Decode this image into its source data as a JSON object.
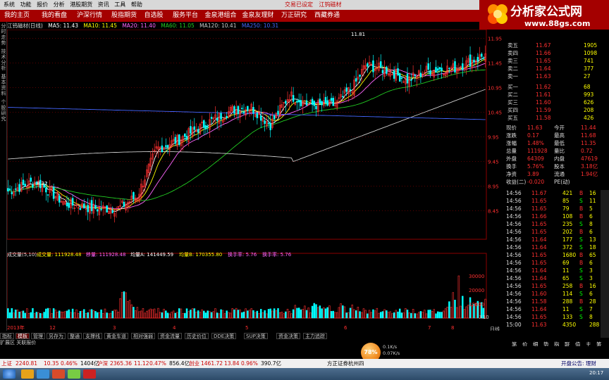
{
  "menu": [
    "系统",
    "功能",
    "报价",
    "分析",
    "港股期货",
    "资讯",
    "工具",
    "帮助"
  ],
  "window_title": "交易已设定",
  "window_stock": "江钨磁材",
  "nav": [
    {
      "label": "我的主页",
      "selected": false
    },
    {
      "label": "我的看盘",
      "selected": false
    },
    {
      "label": "沪深行情",
      "selected": false
    },
    {
      "label": "股指期货",
      "selected": false
    },
    {
      "label": "自选股",
      "selected": false
    },
    {
      "label": "服务平台",
      "selected": false
    },
    {
      "label": "金泉港组合",
      "selected": false
    },
    {
      "label": "金泉友理财",
      "selected": false
    },
    {
      "label": "万正研究",
      "selected": false
    },
    {
      "label": "西藏券通",
      "selected": false
    }
  ],
  "logo": {
    "title": "分析家公式网",
    "url": "www.88gs.com"
  },
  "left_tabs": [
    "分时走势",
    "技术分析",
    "基本资料",
    "个股研究"
  ],
  "info": {
    "stock": "江钨磁材(日线)",
    "ma5": "MA5: 11.43",
    "ma10": "MA10: 11.45",
    "ma20": "MA20: 11.40",
    "ma60": "MA60: 11.05",
    "ma120": "MA120: 10.41",
    "ma250": "MA250: 10.31"
  },
  "chart_data": [
    {
      "type": "candlestick",
      "title": "江钨磁材(日线)",
      "ylim": [
        7.9,
        12.1
      ],
      "yticks": [
        "11.95",
        "11.45",
        "10.95",
        "10.45",
        "9.95",
        "9.45",
        "8.95",
        "8.45"
      ],
      "ytick_values": [
        11.95,
        11.45,
        10.95,
        10.45,
        9.95,
        9.45,
        8.95,
        8.45
      ],
      "annotations": [
        "11.81",
        "8.32"
      ],
      "series": [
        {
          "name": "MA5",
          "color": "#ffffff"
        },
        {
          "name": "MA10",
          "color": "#ffff00"
        },
        {
          "name": "MA20",
          "color": "#ff66ff"
        },
        {
          "name": "MA60",
          "color": "#22cc22"
        },
        {
          "name": "MA120",
          "color": "#cccccc"
        },
        {
          "name": "MA250",
          "color": "#4466ff"
        }
      ]
    },
    {
      "type": "bar",
      "title": "成交量",
      "ylim": [
        0,
        40000
      ],
      "yticks": [
        "30000",
        "20000",
        "10000"
      ],
      "ytick_values": [
        30000,
        20000,
        10000
      ],
      "x_labels": [
        "2013年",
        "12",
        "3",
        "4",
        "5",
        "6",
        "7",
        "8"
      ]
    }
  ],
  "vol_header": {
    "label": "成交量(5,10)",
    "vol": "成交量: 111928.48",
    "ma5": "均量A: 141449.59",
    "ma10": "均量B: 170355.80",
    "turnover": "换手率: 5.76",
    "extra": "移量: 111928.48",
    "extra2": "换手率: 5.76"
  },
  "x_scale": "X10",
  "period": "日线",
  "bottom_tabs": [
    "指标",
    "模板",
    "管理",
    "另存为",
    "整通",
    "支撑线",
    "黄金车道",
    "相对强弱",
    "资金流量",
    "历史价位",
    "DDE决策",
    "SUP决策",
    "资金决策",
    "主力追踪"
  ],
  "bottom_selected": "模板",
  "expand_label": "扩展区 关联报价",
  "order_book": [
    {
      "label": "卖五",
      "price": "11.67",
      "vol": "1905"
    },
    {
      "label": "卖四",
      "price": "11.66",
      "vol": "1098"
    },
    {
      "label": "卖三",
      "price": "11.65",
      "vol": "741"
    },
    {
      "label": "卖二",
      "price": "11.64",
      "vol": "377"
    },
    {
      "label": "卖一",
      "price": "11.63",
      "vol": "27"
    },
    {
      "label": "买一",
      "price": "11.62",
      "vol": "68"
    },
    {
      "label": "买二",
      "price": "11.61",
      "vol": "993"
    },
    {
      "label": "买三",
      "price": "11.60",
      "vol": "626"
    },
    {
      "label": "买四",
      "price": "11.59",
      "vol": "208"
    },
    {
      "label": "买五",
      "price": "11.58",
      "vol": "426"
    }
  ],
  "stats": [
    {
      "k1": "现价",
      "v1": "11.63",
      "k2": "今开",
      "v2": "11.44"
    },
    {
      "k1": "涨跌",
      "v1": "0.17",
      "k2": "最高",
      "v2": "11.68"
    },
    {
      "k1": "涨幅",
      "v1": "1.48%",
      "k2": "最低",
      "v2": "11.35"
    },
    {
      "k1": "总量",
      "v1": "111928",
      "k2": "量比",
      "v2": "0.72"
    },
    {
      "k1": "外盘",
      "v1": "64309",
      "k2": "内盘",
      "v2": "47619"
    },
    {
      "k1": "换手",
      "v1": "5.76%",
      "k2": "股本",
      "v2": "3.18亿"
    },
    {
      "k1": "净资",
      "v1": "3.89",
      "k2": "流通",
      "v2": "1.94亿"
    },
    {
      "k1": "收益(二)",
      "v1": "-0.020",
      "k2": "PE(动)",
      "v2": ""
    }
  ],
  "ticks": [
    {
      "time": "14:56",
      "price": "11.67",
      "vol": "421",
      "side": "B",
      "n": "16"
    },
    {
      "time": "14:56",
      "price": "11.65",
      "vol": "85",
      "side": "S",
      "n": "11"
    },
    {
      "time": "14:56",
      "price": "11.65",
      "vol": "79",
      "side": "B",
      "n": "5"
    },
    {
      "time": "14:56",
      "price": "11.66",
      "vol": "108",
      "side": "B",
      "n": "6"
    },
    {
      "time": "14:56",
      "price": "11.65",
      "vol": "235",
      "side": "S",
      "n": "8"
    },
    {
      "time": "14:56",
      "price": "11.65",
      "vol": "202",
      "side": "B",
      "n": "6"
    },
    {
      "time": "14:56",
      "price": "11.64",
      "vol": "177",
      "side": "S",
      "n": "13"
    },
    {
      "time": "14:56",
      "price": "11.64",
      "vol": "372",
      "side": "S",
      "n": "18"
    },
    {
      "time": "14:56",
      "price": "11.65",
      "vol": "1680",
      "side": "B",
      "n": "65"
    },
    {
      "time": "14:56",
      "price": "11.65",
      "vol": "69",
      "side": "B",
      "n": "6"
    },
    {
      "time": "14:56",
      "price": "11.64",
      "vol": "11",
      "side": "S",
      "n": "3"
    },
    {
      "time": "14:56",
      "price": "11.64",
      "vol": "65",
      "side": "S",
      "n": "3"
    },
    {
      "time": "14:56",
      "price": "11.65",
      "vol": "258",
      "side": "B",
      "n": "16"
    },
    {
      "time": "14:56",
      "price": "11.60",
      "vol": "114",
      "side": "S",
      "n": "6"
    },
    {
      "time": "14:56",
      "price": "11.58",
      "vol": "288",
      "side": "B",
      "n": "28"
    },
    {
      "time": "14:56",
      "price": "11.64",
      "vol": "11",
      "side": "S",
      "n": "7"
    },
    {
      "time": "14:56",
      "price": "11.65",
      "vol": "133",
      "side": "S",
      "n": "8"
    },
    {
      "time": "15:00",
      "price": "11.63",
      "vol": "4350",
      "side": "",
      "n": "288"
    }
  ],
  "right_tabs": [
    "笔",
    "价",
    "细",
    "势",
    "指",
    "联",
    "值",
    "主",
    "筹"
  ],
  "orb": {
    "label": "78%",
    "up": "0.1K/s",
    "down": "0.07K/s"
  },
  "status": {
    "sh_label": "上证",
    "sh_val": "2240.81",
    "sh_chg": "10.35",
    "sh_pct": "0.46%",
    "sh_amt": "1404亿",
    "hs_label": "沪深",
    "hs_val": "2365.36",
    "hs_chg": "11.12",
    "hs_pct": "0.47%",
    "hs_amt": "856.4亿",
    "cy_label": "创业",
    "cy_val": "1461.72",
    "cy_chg": "13.84",
    "cy_pct": "0.96%",
    "cy_amt": "390.7亿",
    "broker": "方正证券杭州四",
    "notice": "开盘公告: 理财"
  },
  "clock": "20:17",
  "colors": {
    "up": "#ff3030",
    "down": "#00ffff",
    "nav": "#a40000"
  }
}
